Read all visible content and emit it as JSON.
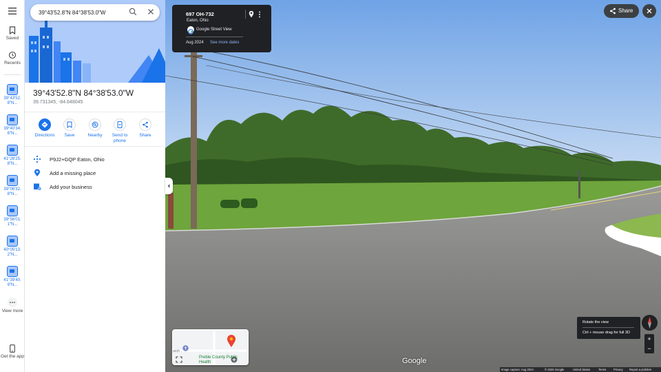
{
  "search": {
    "value": "39°43'52.8\"N 84°38'53.0\"W"
  },
  "rail": {
    "saved_label": "Saved",
    "recents_label": "Recents",
    "recents": [
      "39°43'52.8\"N...",
      "39°40'34.6\"N...",
      "41°28'25.8\"N...",
      "39°06'32.8\"N...",
      "39°56'01.1\"N...",
      "40°05'13.2\"N...",
      "41°39'40.9\"N..."
    ],
    "view_more_label": "View more",
    "get_app_label": "Get the app"
  },
  "place": {
    "title": "39°43'52.8\"N 84°38'53.0\"W",
    "coords": "39.731345, -84.648045"
  },
  "actions": {
    "directions": "Directions",
    "save": "Save",
    "nearby": "Nearby",
    "send_to_phone": "Send to phone",
    "share": "Share"
  },
  "info": {
    "plus_code": "P9J2+GQP Eaton, Ohio",
    "add_place": "Add a missing place",
    "add_business": "Add your business"
  },
  "street_view_card": {
    "address": "697 OH-732",
    "city": "Eaton, Ohio",
    "source": "Google Street View",
    "date": "Aug 2024",
    "more_dates": "See more dates"
  },
  "top_right": {
    "share_label": "Share"
  },
  "controls": {
    "tooltip_line1": "Rotate the view",
    "tooltip_line2": "Ctrl + mouse drag for full 3D",
    "zoom_in": "+",
    "zoom_out": "−"
  },
  "minimap": {
    "label": "Preble County Public Health",
    "church": "urch"
  },
  "brand": "Google",
  "footer": {
    "capture": "Image capture: Aug 2024",
    "copyright": "© 2025 Google",
    "country": "United States",
    "terms": "Terms",
    "privacy": "Privacy",
    "report": "Report a problem"
  },
  "colors": {
    "accent": "#1a73e8",
    "hero_bg": "#aecbfa",
    "card_bg": "#202124"
  }
}
